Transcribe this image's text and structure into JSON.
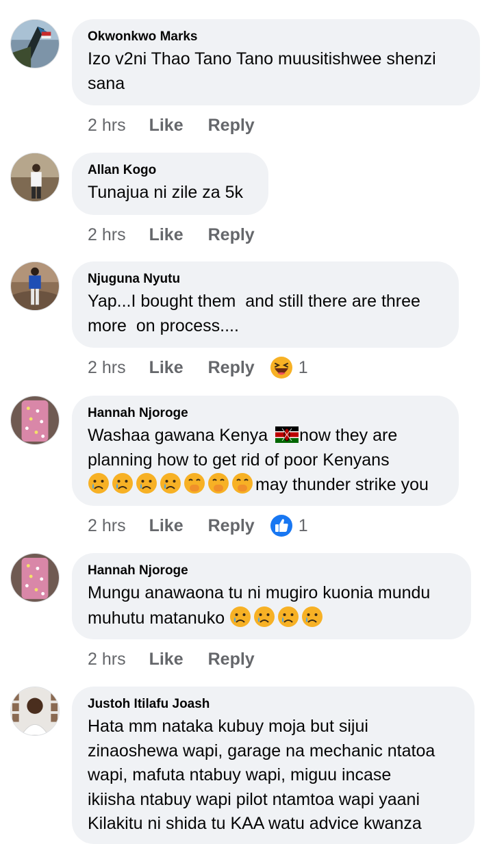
{
  "comments": [
    {
      "author": "Okwonkwo Marks",
      "text_line1": "Izo v2ni Thao Tano Tano muusitishwee shenzi",
      "text_line2": "sana",
      "time": "2 hrs",
      "like": "Like",
      "reply": "Reply"
    },
    {
      "author": "Allan Kogo",
      "text_line1": "Tunajua ni zile za 5k",
      "time": "2 hrs",
      "like": "Like",
      "reply": "Reply"
    },
    {
      "author": "Njuguna Nyutu",
      "text_line1": "Yap...I bought them  and still there are three",
      "text_line2": "more  on process....",
      "time": "2 hrs",
      "like": "Like",
      "reply": "Reply",
      "reaction_icon": "laughing-haha-icon",
      "reaction_count": "1"
    },
    {
      "author": "Hannah Njoroge",
      "text_part1": "Washaa gawana Kenya ",
      "text_part2": "now they are",
      "text_line2": "planning how to get rid of poor Kenyans",
      "text_part3": "may thunder strike you",
      "time": "2 hrs",
      "like": "Like",
      "reply": "Reply",
      "reaction_icon": "thumbs-up-like-icon",
      "reaction_count": "1"
    },
    {
      "author": "Hannah Njoroge",
      "text_line1": "Mungu anawaona tu ni mugiro kuonia mundu",
      "text_line2": "muhutu matanuko ",
      "time": "2 hrs",
      "like": "Like",
      "reply": "Reply"
    },
    {
      "author": "Justoh Itilafu Joash",
      "text_line1": "Hata mm nataka kubuy moja but sijui",
      "text_line2": "zinaoshewa wapi, garage na mechanic ntatoa",
      "text_line3": "wapi, mafuta ntabuy wapi, miguu incase",
      "text_line4": "ikiisha ntabuy wapi pilot ntamtoa wapi yaani",
      "text_line5": "Kilakitu ni shida tu KAA watu advice kwanza"
    }
  ],
  "colors": {
    "bubble": "#f0f2f5",
    "meta_text": "#65676b",
    "like_blue": "#1877f2",
    "kenya_flag": [
      "#000000",
      "#bb0000",
      "#006600",
      "#ffffff"
    ]
  }
}
